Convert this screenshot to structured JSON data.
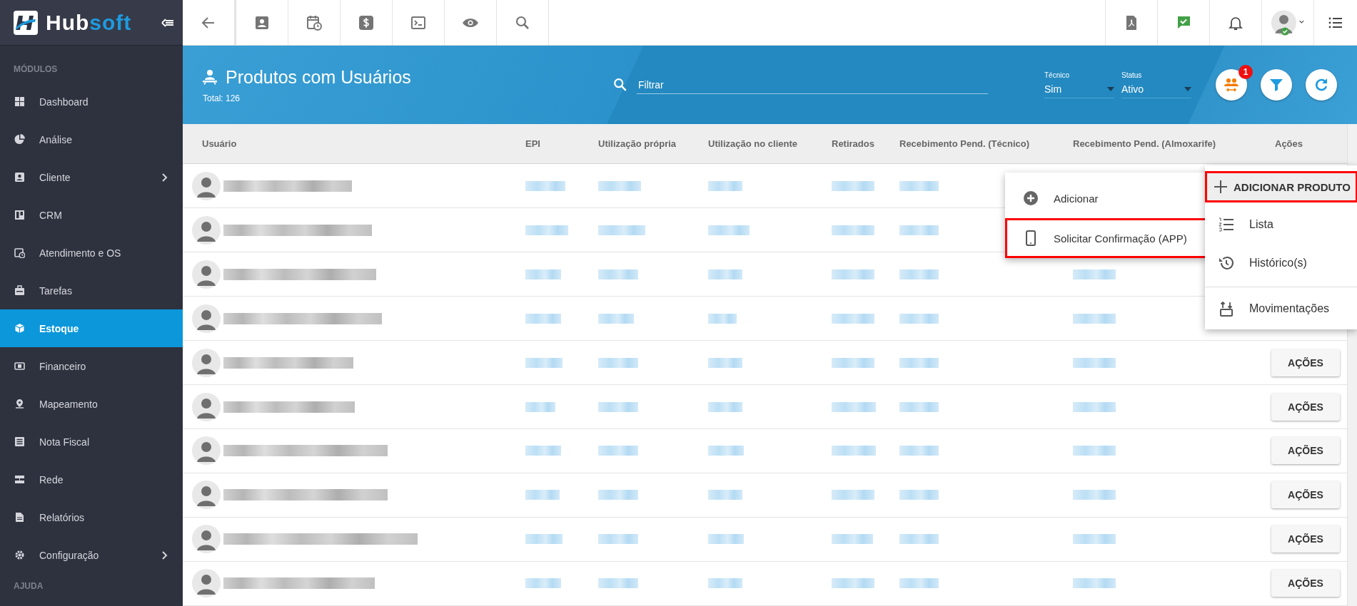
{
  "sidebar": {
    "brand": {
      "part1": "Hub",
      "part2": "soft"
    },
    "sections": [
      {
        "title": "MÓDULOS",
        "items": [
          {
            "label": "Dashboard",
            "selected": false,
            "has_submenu": false
          },
          {
            "label": "Análise",
            "selected": false,
            "has_submenu": false
          },
          {
            "label": "Cliente",
            "selected": false,
            "has_submenu": true
          },
          {
            "label": "CRM",
            "selected": false,
            "has_submenu": false
          },
          {
            "label": "Atendimento e OS",
            "selected": false,
            "has_submenu": false
          },
          {
            "label": "Tarefas",
            "selected": false,
            "has_submenu": false
          },
          {
            "label": "Estoque",
            "selected": true,
            "has_submenu": false
          },
          {
            "label": "Financeiro",
            "selected": false,
            "has_submenu": false
          },
          {
            "label": "Mapeamento",
            "selected": false,
            "has_submenu": false
          },
          {
            "label": "Nota Fiscal",
            "selected": false,
            "has_submenu": false
          },
          {
            "label": "Rede",
            "selected": false,
            "has_submenu": false
          },
          {
            "label": "Relatórios",
            "selected": false,
            "has_submenu": false
          },
          {
            "label": "Configuração",
            "selected": false,
            "has_submenu": true
          }
        ]
      },
      {
        "title": "AJUDA"
      }
    ]
  },
  "topbar": {
    "user": {
      "online": true
    }
  },
  "header": {
    "title": "Produtos com Usuários",
    "total": "Total: 126",
    "filter": {
      "placeholder": "Filtrar"
    },
    "selects": [
      {
        "label": "Técnico",
        "value": "Sim"
      },
      {
        "label": "Status",
        "value": "Ativo"
      }
    ],
    "badge": "1"
  },
  "table": {
    "columns": [
      "Usuário",
      "EPI",
      "Utilização própria",
      "Utilização no cliente",
      "Retirados",
      "Recebimento Pend. (Técnico)",
      "Recebimento Pend. (Almoxarife)",
      "Ações"
    ],
    "rows": [
      {},
      {},
      {},
      {},
      {
        "action": "AÇÕES"
      },
      {
        "action": "AÇÕES"
      },
      {
        "action": "AÇÕES"
      },
      {
        "action": "AÇÕES"
      },
      {
        "action": "AÇÕES"
      },
      {
        "action": "AÇÕES"
      }
    ]
  },
  "row_menu": [
    {
      "label": "Adicionar",
      "highlighted": false
    },
    {
      "label": "Solicitar Confirmação (APP)",
      "highlighted": true
    }
  ],
  "actions_menu": [
    {
      "label": "ADICIONAR PRODUTO",
      "kind": "primary",
      "highlighted": true,
      "divider_before": false
    },
    {
      "label": "Lista",
      "kind": "item",
      "highlighted": false,
      "divider_before": false
    },
    {
      "label": "Histórico(s)",
      "kind": "item",
      "highlighted": false,
      "divider_before": false
    },
    {
      "label": "Movimentações",
      "kind": "item",
      "highlighted": false,
      "divider_before": true
    }
  ]
}
